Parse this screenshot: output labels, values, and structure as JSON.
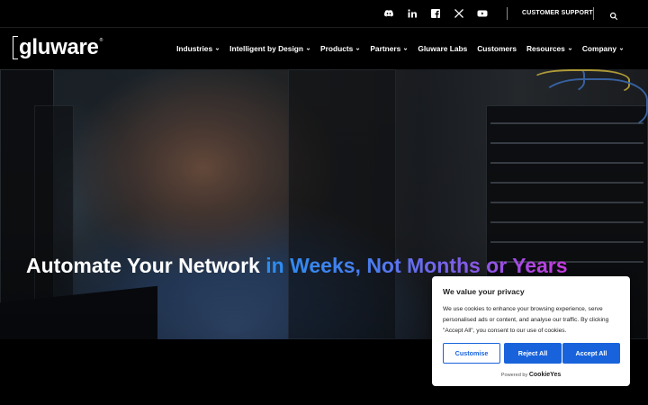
{
  "utility": {
    "social_icons": [
      "discord-icon",
      "linkedin-icon",
      "facebook-icon",
      "x-icon",
      "youtube-icon"
    ],
    "support_label": "CUSTOMER SUPPORT"
  },
  "logo": {
    "text": "gluware",
    "reg": "®"
  },
  "nav": {
    "items": [
      {
        "label": "Industries",
        "dropdown": true
      },
      {
        "label": "Intelligent by Design",
        "dropdown": true
      },
      {
        "label": "Products",
        "dropdown": true
      },
      {
        "label": "Partners",
        "dropdown": true
      },
      {
        "label": "Gluware Labs",
        "dropdown": false
      },
      {
        "label": "Customers",
        "dropdown": false
      },
      {
        "label": "Resources",
        "dropdown": true
      },
      {
        "label": "Company",
        "dropdown": true
      }
    ]
  },
  "hero": {
    "headline_white": "Automate Your Network",
    "headline_gradient": "in Weeks, Not Months or Years",
    "gradient_colors": [
      "#2a8ef0",
      "#c83ae0"
    ]
  },
  "cookie": {
    "title": "We value your privacy",
    "body": "We use cookies to enhance your browsing experience, serve personalised ads or content, and analyse our traffic. By clicking \"Accept All\", you consent to our use of cookies.",
    "customise_label": "Customise",
    "reject_label": "Reject All",
    "accept_label": "Accept All",
    "powered_prefix": "Powered by",
    "powered_brand": "CookieYes",
    "accent": "#1863dc"
  }
}
